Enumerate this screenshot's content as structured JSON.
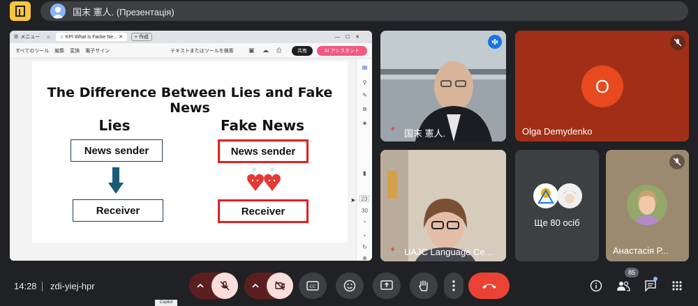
{
  "header": {
    "presenter_label": "国末 憲人. (Презентація)"
  },
  "shared_screen": {
    "browser": {
      "menu_label": "メニュー",
      "tab_title": "KPI What is Facke Ne...",
      "new_tab_label": "作成"
    },
    "toolbar": {
      "items": [
        "すべてのツール",
        "編集",
        "変換",
        "電子サイン"
      ],
      "search_hint": "テキストまたはツールを検索",
      "share_label": "共有",
      "ai_label": "AI アシスタント"
    },
    "slide": {
      "title": "The Difference Between Lies and Fake News",
      "left_heading": "Lies",
      "right_heading": "Fake News",
      "left_sender": "News sender",
      "left_receiver": "Receiver",
      "right_sender": "News sender",
      "right_receiver": "Receiver"
    },
    "page_numbers": [
      "23",
      "30"
    ]
  },
  "participants": [
    {
      "name": "国末 憲人.",
      "speaking": true
    },
    {
      "name": "Olga Demydenko",
      "initial": "O",
      "muted": true
    },
    {
      "name": "UAJC Language Ce...",
      "muted": false
    },
    {
      "name": "Ще 80 осіб"
    },
    {
      "name": "Анастасія Р...",
      "muted": true
    }
  ],
  "footer": {
    "time": "14:28",
    "meeting_code": "zdi-yiej-hpr",
    "participant_count": "85",
    "tooltip": "Copilot"
  },
  "colors": {
    "background": "#202124",
    "accent_red": "#ea4335",
    "muted_control": "#f9dedc",
    "olga_tile": "#a12f17",
    "avatar_orange": "#e8491f"
  }
}
